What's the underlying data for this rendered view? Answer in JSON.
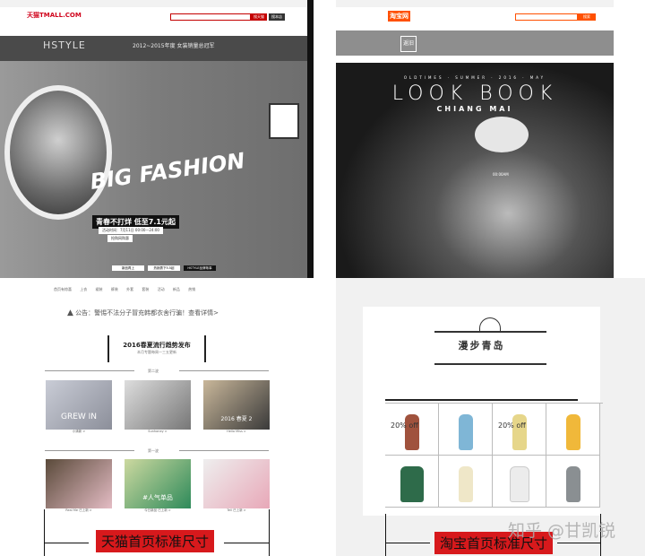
{
  "tmall": {
    "logo": "天猫TMALL.COM",
    "search_btn": "搜天猫",
    "search_btn2": "搜本店",
    "brand": "HSTYLE",
    "award": "2012~2015年度 女装销量总冠军",
    "headline": "BIG FASHION",
    "promo": "青春不打烊 低至7.1元起",
    "promo_time": "活动时间：7月11日 00:00—24:00",
    "promo_link": "抢购网购惠",
    "banner_buttons": [
      "新品再上",
      "热销男下5.5起",
      "HSTYLE品牌故事"
    ],
    "nav": "首页有惊喜 上衣 裙装 裤装 外套 套装 活动 新品 热销",
    "notice_label": "公告：",
    "notice": "警惕不法分子冒充韩都衣舍行骗！查看详情>",
    "section_title": "2016春夏流行趋势发布",
    "section_sub": "本月专题每周一三五更新",
    "divider1": "第二波",
    "divider2": "第一波",
    "cards": [
      {
        "overlay": "GREW IN",
        "caption": "小清新 >"
      },
      {
        "overlay": "",
        "caption": "Sunhoney >"
      },
      {
        "overlay": "2016 春夏 2",
        "caption": "Hello Miss >"
      },
      {
        "overlay": "",
        "caption": "Real Me 已上新 >"
      },
      {
        "overlay": "#人气单品",
        "caption": "今日新品 已上新 >"
      },
      {
        "overlay": "",
        "caption": "Tell 已上新 >"
      }
    ],
    "label": "天猫首页标准尺寸"
  },
  "taobao": {
    "logo": "淘宝网",
    "search_btn": "搜索",
    "shop_logo": "返旧",
    "lookbook_sub": "OLDTIMES · SUMMER · 2016 · MAY",
    "lookbook": "LOOK BOOK",
    "city": "CHIANG MAI",
    "time": "00:00AM",
    "panel_title": "漫步青岛",
    "discount": "20% off",
    "product_count": 8,
    "label": "淘宝首页标准尺寸"
  },
  "watermark": "知乎 @甘凯锐"
}
